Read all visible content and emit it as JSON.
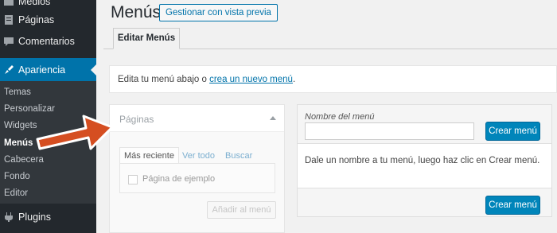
{
  "sidebar": {
    "items": [
      {
        "label": "Medios"
      },
      {
        "label": "Páginas"
      },
      {
        "label": "Comentarios"
      },
      {
        "label": "Apariencia"
      },
      {
        "label": "Plugins"
      }
    ],
    "submenu": [
      "Temas",
      "Personalizar",
      "Widgets",
      "Menús",
      "Cabecera",
      "Fondo",
      "Editor"
    ]
  },
  "header": {
    "title": "Menús",
    "preview_button": "Gestionar con vista previa"
  },
  "tabs": [
    {
      "label": "Editar Menús"
    }
  ],
  "notice": {
    "text_before": "Edita tu menú abajo o ",
    "link": "crea un nuevo menú",
    "text_after": "."
  },
  "pages_panel": {
    "title": "Páginas",
    "tabs": [
      "Más reciente",
      "Ver todo",
      "Buscar"
    ],
    "items": [
      "Página de ejemplo"
    ],
    "add_button": "Añadir al menú"
  },
  "menu_panel": {
    "name_label": "Nombre del menú",
    "name_value": "",
    "create_button": "Crear menú",
    "instructions": "Dale un nombre a tu menú, luego haz clic en Crear menú.",
    "create_button_bottom": "Crear menú"
  },
  "colors": {
    "accent": "#0073aa",
    "sidebar_bg": "#23282d",
    "arrow": "#d54e21"
  }
}
